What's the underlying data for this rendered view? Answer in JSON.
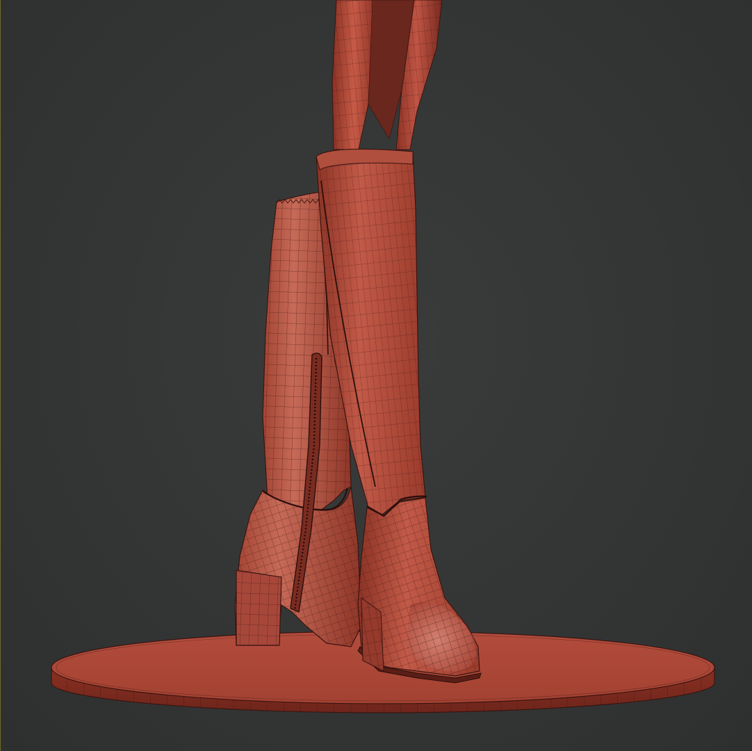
{
  "scene": {
    "subject": "",
    "colors": {
      "background": "#333535",
      "mesh_fill": "#b84c3c",
      "mesh_fill_dark": "#7e2c22",
      "mesh_highlight": "#cf6a58",
      "wire": "#3a1410"
    },
    "icons": [
      "knee-high-boot-left-icon",
      "knee-high-boot-right-icon",
      "display-base-icon"
    ]
  }
}
